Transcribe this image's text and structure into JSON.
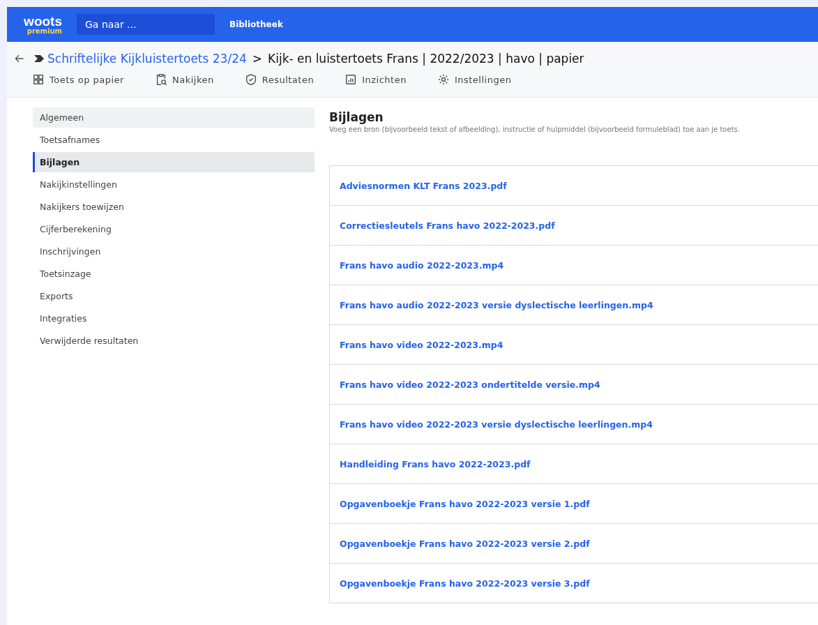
{
  "topbar": {
    "logo": "woots",
    "logo_sub": "premium",
    "search": {
      "placeholder": "Ga naar ..."
    },
    "links": [
      "Bibliotheek"
    ]
  },
  "breadcrumb": {
    "parent": "Schriftelijke Kijkluistertoets 23/24",
    "separator": ">",
    "current": "Kijk- en luistertoets Frans | 2022/2023 | havo | papier"
  },
  "tabs": [
    "Toets op papier",
    "Nakijken",
    "Resultaten",
    "Inzichten",
    "Instellingen"
  ],
  "sidebar": {
    "items": [
      {
        "label": "Algemeen",
        "selected": false,
        "hovered": true
      },
      {
        "label": "Toetsafnames",
        "selected": false,
        "hovered": false
      },
      {
        "label": "Bijlagen",
        "selected": true,
        "hovered": false
      },
      {
        "label": "Nakijkinstellingen",
        "selected": false,
        "hovered": false
      },
      {
        "label": "Nakijkers toewijzen",
        "selected": false,
        "hovered": false
      },
      {
        "label": "Cijferberekening",
        "selected": false,
        "hovered": false
      },
      {
        "label": "Inschrijvingen",
        "selected": false,
        "hovered": false
      },
      {
        "label": "Toetsinzage",
        "selected": false,
        "hovered": false
      },
      {
        "label": "Exports",
        "selected": false,
        "hovered": false
      },
      {
        "label": "Integraties",
        "selected": false,
        "hovered": false
      },
      {
        "label": "Verwijderde resultaten",
        "selected": false,
        "hovered": false
      }
    ]
  },
  "section": {
    "title": "Bijlagen",
    "description": "Voeg een bron (bijvoorbeeld tekst of afbeelding), instructie of hulpmiddel (bijvoorbeeld formuleblad) toe aan je toets."
  },
  "attachments": [
    "Adviesnormen KLT Frans 2023.pdf",
    "Correctiesleutels Frans havo 2022-2023.pdf",
    "Frans havo audio 2022-2023.mp4",
    "Frans havo audio 2022-2023 versie dyslectische leerlingen.mp4",
    "Frans havo video 2022-2023.mp4",
    "Frans havo video 2022-2023 ondertitelde versie.mp4",
    "Frans havo video 2022-2023 versie dyslectische leerlingen.mp4",
    "Handleiding Frans havo 2022-2023.pdf",
    "Opgavenboekje Frans havo 2022-2023 versie 1.pdf",
    "Opgavenboekje Frans havo 2022-2023 versie 2.pdf",
    "Opgavenboekje Frans havo 2022-2023 versie 3.pdf"
  ]
}
